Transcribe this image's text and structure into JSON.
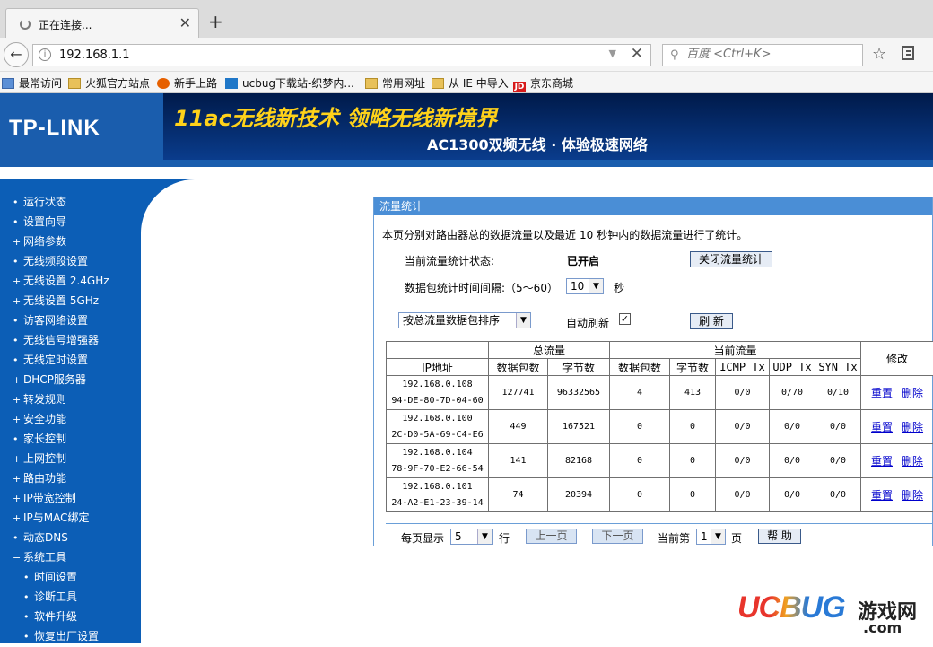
{
  "browser": {
    "tab_title": "正在连接...",
    "url": "192.168.1.1",
    "search_placeholder": "百度 <Ctrl+K>",
    "bookmarks": [
      "最常访问",
      "火狐官方站点",
      "新手上路",
      "ucbug下载站-织梦内...",
      "常用网址",
      "从 IE 中导入",
      "京东商城"
    ]
  },
  "header": {
    "logo": "TP-LINK",
    "banner_line1": "11ac无线新技术 领略无线新境界",
    "banner_line2": "AC1300双频无线 · 体验极速网络"
  },
  "sidebar": {
    "items": [
      {
        "label": "运行状态",
        "bullet": "•"
      },
      {
        "label": "设置向导",
        "bullet": "•"
      },
      {
        "label": "网络参数",
        "bullet": "+"
      },
      {
        "label": "无线频段设置",
        "bullet": "•"
      },
      {
        "label": "无线设置 2.4GHz",
        "bullet": "+"
      },
      {
        "label": "无线设置 5GHz",
        "bullet": "+"
      },
      {
        "label": "访客网络设置",
        "bullet": "•"
      },
      {
        "label": "无线信号增强器",
        "bullet": "•"
      },
      {
        "label": "无线定时设置",
        "bullet": "•"
      },
      {
        "label": "DHCP服务器",
        "bullet": "+"
      },
      {
        "label": "转发规则",
        "bullet": "+"
      },
      {
        "label": "安全功能",
        "bullet": "+"
      },
      {
        "label": "家长控制",
        "bullet": "•"
      },
      {
        "label": "上网控制",
        "bullet": "+"
      },
      {
        "label": "路由功能",
        "bullet": "+"
      },
      {
        "label": "IP带宽控制",
        "bullet": "+"
      },
      {
        "label": "IP与MAC绑定",
        "bullet": "+"
      },
      {
        "label": "动态DNS",
        "bullet": "•"
      },
      {
        "label": "系统工具",
        "bullet": "−"
      }
    ],
    "sub_items": [
      "时间设置",
      "诊断工具",
      "软件升级",
      "恢复出厂设置"
    ]
  },
  "panel": {
    "title": "流量统计",
    "intro_before": "本页分别对路由器总的数据流量以及最近",
    "intro_num": "10",
    "intro_after": "秒钟内的数据流量进行了统计。",
    "status_label": "当前流量统计状态:",
    "status_value": "已开启",
    "toggle_button": "关闭流量统计",
    "interval_label": "数据包统计时间间隔:（5～60）",
    "interval_value": "10",
    "interval_unit": "秒",
    "sort_value": "按总流量数据包排序",
    "auto_refresh_label": "自动刷新",
    "refresh_button": "刷 新",
    "table": {
      "group_total": "总流量",
      "group_current": "当前流量",
      "col_modify": "修改",
      "col_ip": "IP地址",
      "col_packets": "数据包数",
      "col_bytes": "字节数",
      "col_cur_packets": "数据包数",
      "col_cur_bytes": "字节数",
      "col_icmp": "ICMP Tx",
      "col_udp": "UDP Tx",
      "col_syn": "SYN Tx",
      "reset": "重置",
      "delete": "删除",
      "rows": [
        {
          "ip": "192.168.0.108",
          "mac": "94-DE-80-7D-04-60",
          "packets": "127741",
          "bytes": "96332565",
          "cur_packets": "4",
          "cur_bytes": "413",
          "icmp": "0/0",
          "udp": "0/70",
          "syn": "0/10"
        },
        {
          "ip": "192.168.0.100",
          "mac": "2C-D0-5A-69-C4-E6",
          "packets": "449",
          "bytes": "167521",
          "cur_packets": "0",
          "cur_bytes": "0",
          "icmp": "0/0",
          "udp": "0/0",
          "syn": "0/0"
        },
        {
          "ip": "192.168.0.104",
          "mac": "78-9F-70-E2-66-54",
          "packets": "141",
          "bytes": "82168",
          "cur_packets": "0",
          "cur_bytes": "0",
          "icmp": "0/0",
          "udp": "0/0",
          "syn": "0/0"
        },
        {
          "ip": "192.168.0.101",
          "mac": "24-A2-E1-23-39-14",
          "packets": "74",
          "bytes": "20394",
          "cur_packets": "0",
          "cur_bytes": "0",
          "icmp": "0/0",
          "udp": "0/0",
          "syn": "0/0"
        }
      ]
    },
    "pager": {
      "per_page_label": "每页显示",
      "per_page_value": "5",
      "per_page_unit": "行",
      "prev": "上一页",
      "next": "下一页",
      "current_label": "当前第",
      "current_value": "1",
      "current_unit": "页",
      "help": "帮 助"
    }
  },
  "watermark": {
    "brand": "UCBUG",
    "cn": "游戏网",
    "com": ".com"
  },
  "colors": {
    "router_blue": "#0c5eb6",
    "banner_yellow": "#ffd21a",
    "panel_head": "#4a8ed6"
  }
}
